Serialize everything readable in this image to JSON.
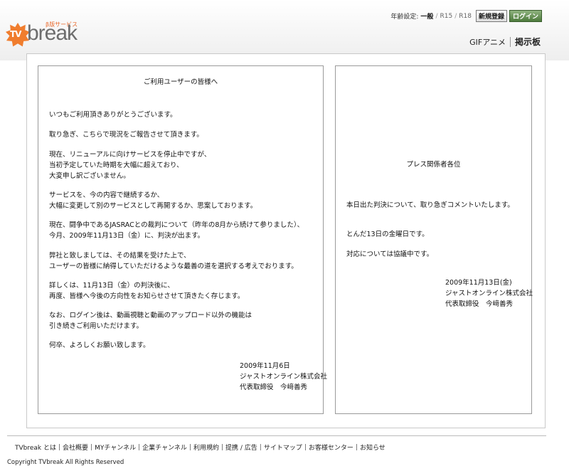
{
  "header": {
    "logo": {
      "tv": "TV",
      "brand": "break",
      "beta": "β版サービス"
    },
    "age": {
      "label": "年齢設定:",
      "current": "一般",
      "sep": "/",
      "r15": "R15",
      "r18": "R18"
    },
    "signup_label": "新規登録",
    "login_label": "ログイン",
    "links": [
      "GIFアニメ",
      "掲示板"
    ]
  },
  "left_panel": {
    "title": "ご利用ユーザーの皆様へ",
    "paragraphs": [
      "いつもご利用頂きありがとうございます。",
      "取り急ぎ、こちらで現況をご報告させて頂きます。",
      "現在、リニューアルに向けサービスを停止中ですが、\n当初予定していた時期を大幅に超えており、\n大変申し訳ございません。",
      "サービスを、今の内容で継続するか、\n大幅に変更して別のサービスとして再開するか、思案しております。",
      "現在、闘争中であるJASRACとの裁判について（昨年の8月から続けて参りました）、\n今月、2009年11月13日（金）に、判決が出ます。",
      "弊社と致しましては、その結果を受けた上で、\nユーザーの皆様に納得していただけるような最善の道を選択する考えでおります。",
      "詳しくは、11月13日（金）の判決後に、\n再度、皆様へ今後の方向性をお知らせさせて頂きたく存じます。",
      "なお、ログイン後は、動画視聴と動画のアップロード以外の機能は\n引き続きご利用いただけます。",
      "何卒、よろしくお願い致します。"
    ],
    "signature": "2009年11月6日\nジャストオンライン株式会社\n代表取締役　今﨑善秀"
  },
  "right_panel": {
    "title": "プレス関係者各位",
    "paragraphs": [
      "本日出た判決について、取り急ぎコメントいたします。",
      "とんだ13日の金曜日です。",
      "対応については協議中です。"
    ],
    "signature": "2009年11月13日(金)\nジャストオンライン株式会社\n代表取締役　今﨑善秀"
  },
  "footer": {
    "links": [
      "TVbreak とは",
      "会社概要",
      "MYチャンネル",
      "企業チャンネル",
      "利用規約",
      "提携 / 広告",
      "サイトマップ",
      "お客様センター",
      "お知らせ"
    ],
    "copyright": "Copyright TVbreak All Rights Reserved"
  },
  "colors": {
    "brand_orange": "#f07d2e",
    "login_green": "#4d7a3c"
  }
}
